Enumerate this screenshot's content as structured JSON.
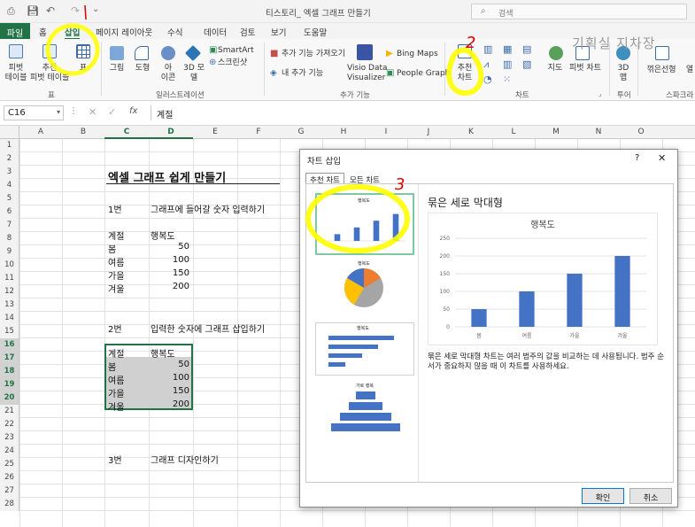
{
  "window": {
    "title": "티스토리_ 엑셀 그래프 만들기",
    "search_placeholder": "검색"
  },
  "tabs": [
    "파일",
    "홈",
    "삽입",
    "페이지 레이아웃",
    "수식",
    "데이터",
    "검토",
    "보기",
    "도움말"
  ],
  "ribbon": {
    "pivot_table": "피벗\n테이블",
    "recommended_pivot": "추천\n피벗 테이블",
    "table": "표",
    "group_table_label": "표",
    "picture": "그림",
    "shapes": "도형",
    "icons": "아\n이콘",
    "models3d": "3D 모\n델",
    "smartart": "SmartArt",
    "screenshot": "스크린샷",
    "group_illustration_label": "일러스트레이션",
    "get_addins": "추가 기능 가져오기",
    "my_addins": "내 추가 기능",
    "visio": "Visio Data\nVisualizer",
    "bing_maps": "Bing Maps",
    "people_graph": "People Graph",
    "group_addins_label": "추가 기능",
    "recommended_charts": "추천\n차트",
    "maps": "지도",
    "pivot_chart": "피벗 차트",
    "map3d": "3D\n맵",
    "group_charts_label": "차트",
    "group_tour_label": "투어",
    "sparkline_line": "꺾은선형",
    "sparkline_col": "열",
    "group_sparkline_label": "스파크라",
    "watermark": "기획실 지차장"
  },
  "formula_bar": {
    "name_box": "C16",
    "fx": "fx",
    "content": "계절"
  },
  "columns": [
    "A",
    "B",
    "C",
    "D",
    "E",
    "F",
    "G",
    "H",
    "I",
    "J",
    "K",
    "L",
    "M",
    "N",
    "O"
  ],
  "rows": [
    "1",
    "2",
    "3",
    "4",
    "5",
    "6",
    "7",
    "8",
    "9",
    "10",
    "11",
    "12",
    "13",
    "14",
    "15",
    "16",
    "17",
    "18",
    "19",
    "20",
    "21",
    "22",
    "23",
    "24",
    "25",
    "26",
    "27",
    "28"
  ],
  "sheet": {
    "heading": "엑셀 그래프 쉽게 만들기",
    "step1_num": "1번",
    "step1_text": "그래프에 들어갈 숫자 입력하기",
    "table1": {
      "h1": "계절",
      "h2": "행복도",
      "rows": [
        [
          "봄",
          "50"
        ],
        [
          "여름",
          "100"
        ],
        [
          "가을",
          "150"
        ],
        [
          "겨울",
          "200"
        ]
      ]
    },
    "step2_num": "2번",
    "step2_text": "입력한 숫자에 그래프 삽입하기",
    "table2": {
      "h1": "계절",
      "h2": "행복도",
      "rows": [
        [
          "봄",
          "50"
        ],
        [
          "여름",
          "100"
        ],
        [
          "가을",
          "150"
        ],
        [
          "겨울",
          "200"
        ]
      ]
    },
    "step3_num": "3번",
    "step3_text": "그래프 디자인하기"
  },
  "dialog": {
    "title": "차트 삽입",
    "help": "?",
    "close": "✕",
    "tab_recommended": "추천 차트",
    "tab_all": "모든 차트",
    "chart_type_title": "묶은 세로 막대형",
    "description": "묶은 세로 막대형 차트는 여러 범주의 값을 비교하는 데 사용됩니다. 범주 순서가 중요하지 않을 때 이 차트를 사용하세요.",
    "ok": "확인",
    "cancel": "취소",
    "thumb1_title": "행복도",
    "thumb2_title": "행복도",
    "thumb3_title": "행복도",
    "thumb4_title": "가로 행복"
  },
  "chart_data": {
    "type": "bar",
    "title": "행복도",
    "categories": [
      "봄",
      "여름",
      "가을",
      "겨울"
    ],
    "values": [
      50,
      100,
      150,
      200
    ],
    "ylim": [
      0,
      250
    ],
    "yticks": [
      "0",
      "50",
      "100",
      "150",
      "200",
      "250"
    ],
    "bar_color": "#4472c4"
  },
  "annotations": {
    "num2": "2",
    "num3": "3"
  },
  "colors": {
    "excel_green": "#217346",
    "highlight": "#ffff00",
    "selection": "#c6c6c6",
    "bar": "#4472c4"
  }
}
